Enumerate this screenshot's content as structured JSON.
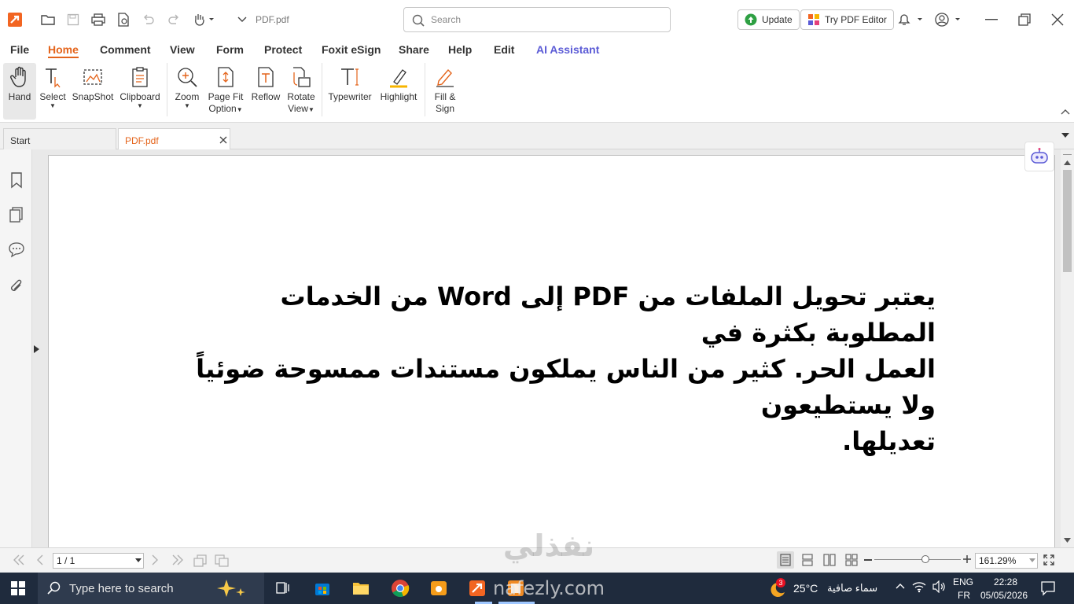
{
  "titlebar": {
    "file_name": "PDF.pdf",
    "search_placeholder": "Search",
    "update_label": "Update",
    "try_editor_label": "Try PDF Editor"
  },
  "menu": [
    "File",
    "Home",
    "Comment",
    "View",
    "Form",
    "Protect",
    "Foxit eSign",
    "Share",
    "Help",
    "Edit",
    "AI Assistant"
  ],
  "ribbon": {
    "hand": "Hand",
    "select": "Select",
    "snapshot": "SnapShot",
    "clipboard": "Clipboard",
    "zoom": "Zoom",
    "page_fit_1": "Page Fit",
    "page_fit_2": "Option",
    "reflow": "Reflow",
    "rotate_1": "Rotate",
    "rotate_2": "View",
    "typewriter": "Typewriter",
    "highlight": "Highlight",
    "fill_1": "Fill &",
    "fill_2": "Sign"
  },
  "tabs": {
    "start": "Start",
    "pdf": "PDF.pdf"
  },
  "document": {
    "lines": [
      "يعتبر تحويل الملفات من PDF إلى Word من الخدمات المطلوبة بكثرة في",
      "العمل الحر. كثير من الناس يملكون مستندات ممسوحة ضوئياً ولا يستطيعون",
      "تعديلها."
    ]
  },
  "statusbar": {
    "page_indicator": "1 / 1",
    "zoom_level": "161.29%"
  },
  "watermark": {
    "arabic": "نفذلي",
    "latin": "nafezly.com"
  },
  "taskbar": {
    "search_placeholder": "Type here to search",
    "weather_temp": "25°C",
    "weather_desc": "سماء صافية",
    "weather_badge": "3",
    "lang_1": "ENG",
    "lang_2": "FR",
    "time": "22:28",
    "date": "05/05/2026"
  },
  "colors": {
    "accent": "#e4641b",
    "ai": "#5b5bd6",
    "taskbar": "#1f2b3d"
  }
}
